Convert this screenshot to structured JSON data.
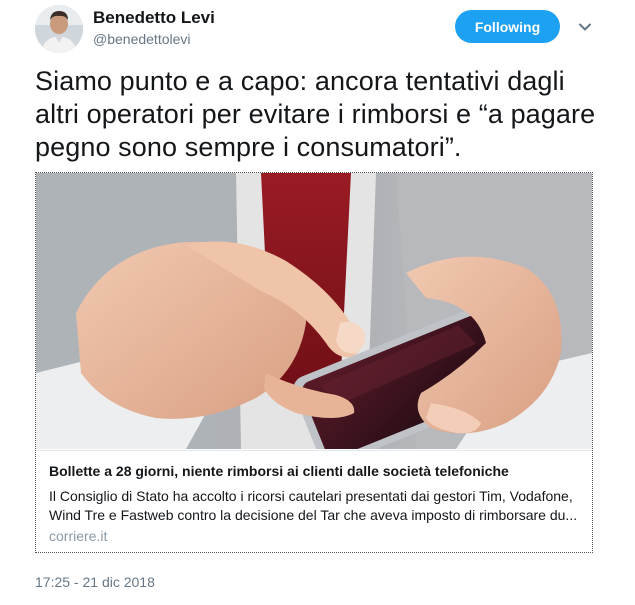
{
  "user": {
    "name": "Benedetto Levi",
    "handle": "@benedettolevi"
  },
  "follow_button": {
    "label": "Following"
  },
  "tweet": {
    "text": "Siamo punto e a capo: ancora tentativi dagli altri operatori per evitare i rimborsi e “a pagare pegno sono sempre i consumatori”.",
    "timestamp": "17:25 - 21 dic 2018"
  },
  "card": {
    "title": "Bollette a 28 giorni, niente rimborsi ai clienti dalle società telefoniche",
    "description": "Il Consiglio di Stato ha accolto i ricorsi cautelari presentati dai gestori Tim, Vodafone, Wind Tre e Fastweb contro la decisione del Tar che aveva imposto di rimborsare du...",
    "domain": "corriere.it",
    "image_icon": "hands-holding-smartphone-photo"
  },
  "colors": {
    "accent": "#1da1f2",
    "text_primary": "#14171a",
    "text_secondary": "#657786"
  },
  "icons": {
    "menu": "chevron-down-icon"
  }
}
